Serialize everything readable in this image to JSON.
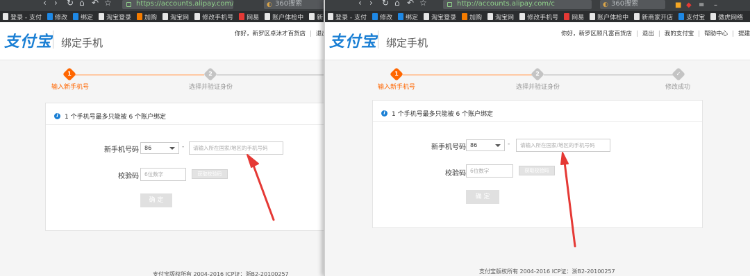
{
  "left": {
    "url": "https://accounts.alipay.com/co",
    "search_label": "360搜索",
    "bookmarks": [
      "登录 - 支付",
      "修改",
      "绑定",
      "淘宝登录",
      "加购",
      "淘宝网",
      "修改手机号",
      "网易",
      "账户体检中",
      "新商家开店"
    ],
    "logo": "支付宝",
    "page_title": "绑定手机",
    "greeting": "你好，新罗区卓沐才百货店",
    "logout": "退出",
    "steps": [
      "输入新手机号",
      "选择并验证身份"
    ],
    "step_numbers": [
      "1",
      "2"
    ],
    "info": "1 个手机号最多只能被 6 个账户绑定",
    "phone_label": "新手机号码",
    "country_code": "86",
    "dash": "-",
    "phone_placeholder": "请输入所在国家/地区的手机号码",
    "code_label": "校验码",
    "code_placeholder": "6位数字",
    "get_code": "获取校验码",
    "confirm": "确 定",
    "footer": "支付宝版权所有 2004-2016 ICP证：浙B2-20100257"
  },
  "right": {
    "url": "http://accounts.alipay.com/c",
    "search_label": "360搜索",
    "bookmarks": [
      "登录 - 支付",
      "修改",
      "绑定",
      "淘宝登录",
      "加购",
      "淘宝网",
      "修改手机号",
      "网易",
      "账户体检中",
      "新商家开店",
      "支付宝",
      "傲虎网络"
    ],
    "logo": "支付宝",
    "page_title": "绑定手机",
    "greeting": "你好，新罗区顾凡富百货店",
    "top_links": [
      "退出",
      "我的支付宝",
      "帮助中心",
      "提建议"
    ],
    "steps": [
      "输入新手机号",
      "选择并验证身份",
      "修改成功"
    ],
    "step_numbers": [
      "1",
      "2"
    ],
    "info": "1 个手机号最多只能被 6 个账户绑定",
    "phone_label": "新手机号码",
    "country_code": "86",
    "dash": "-",
    "phone_placeholder": "请输入所在国家/地区的手机号码",
    "code_label": "校验码",
    "code_placeholder": "6位数字",
    "get_code": "获取校验码",
    "confirm": "确 定",
    "footer": "支付宝版权所有 2004-2016 ICP证：浙B2-20100257"
  },
  "colors": {
    "accent": "#ff6600",
    "brand": "#1a7fd4",
    "annotation_arrow": "#e53935"
  }
}
